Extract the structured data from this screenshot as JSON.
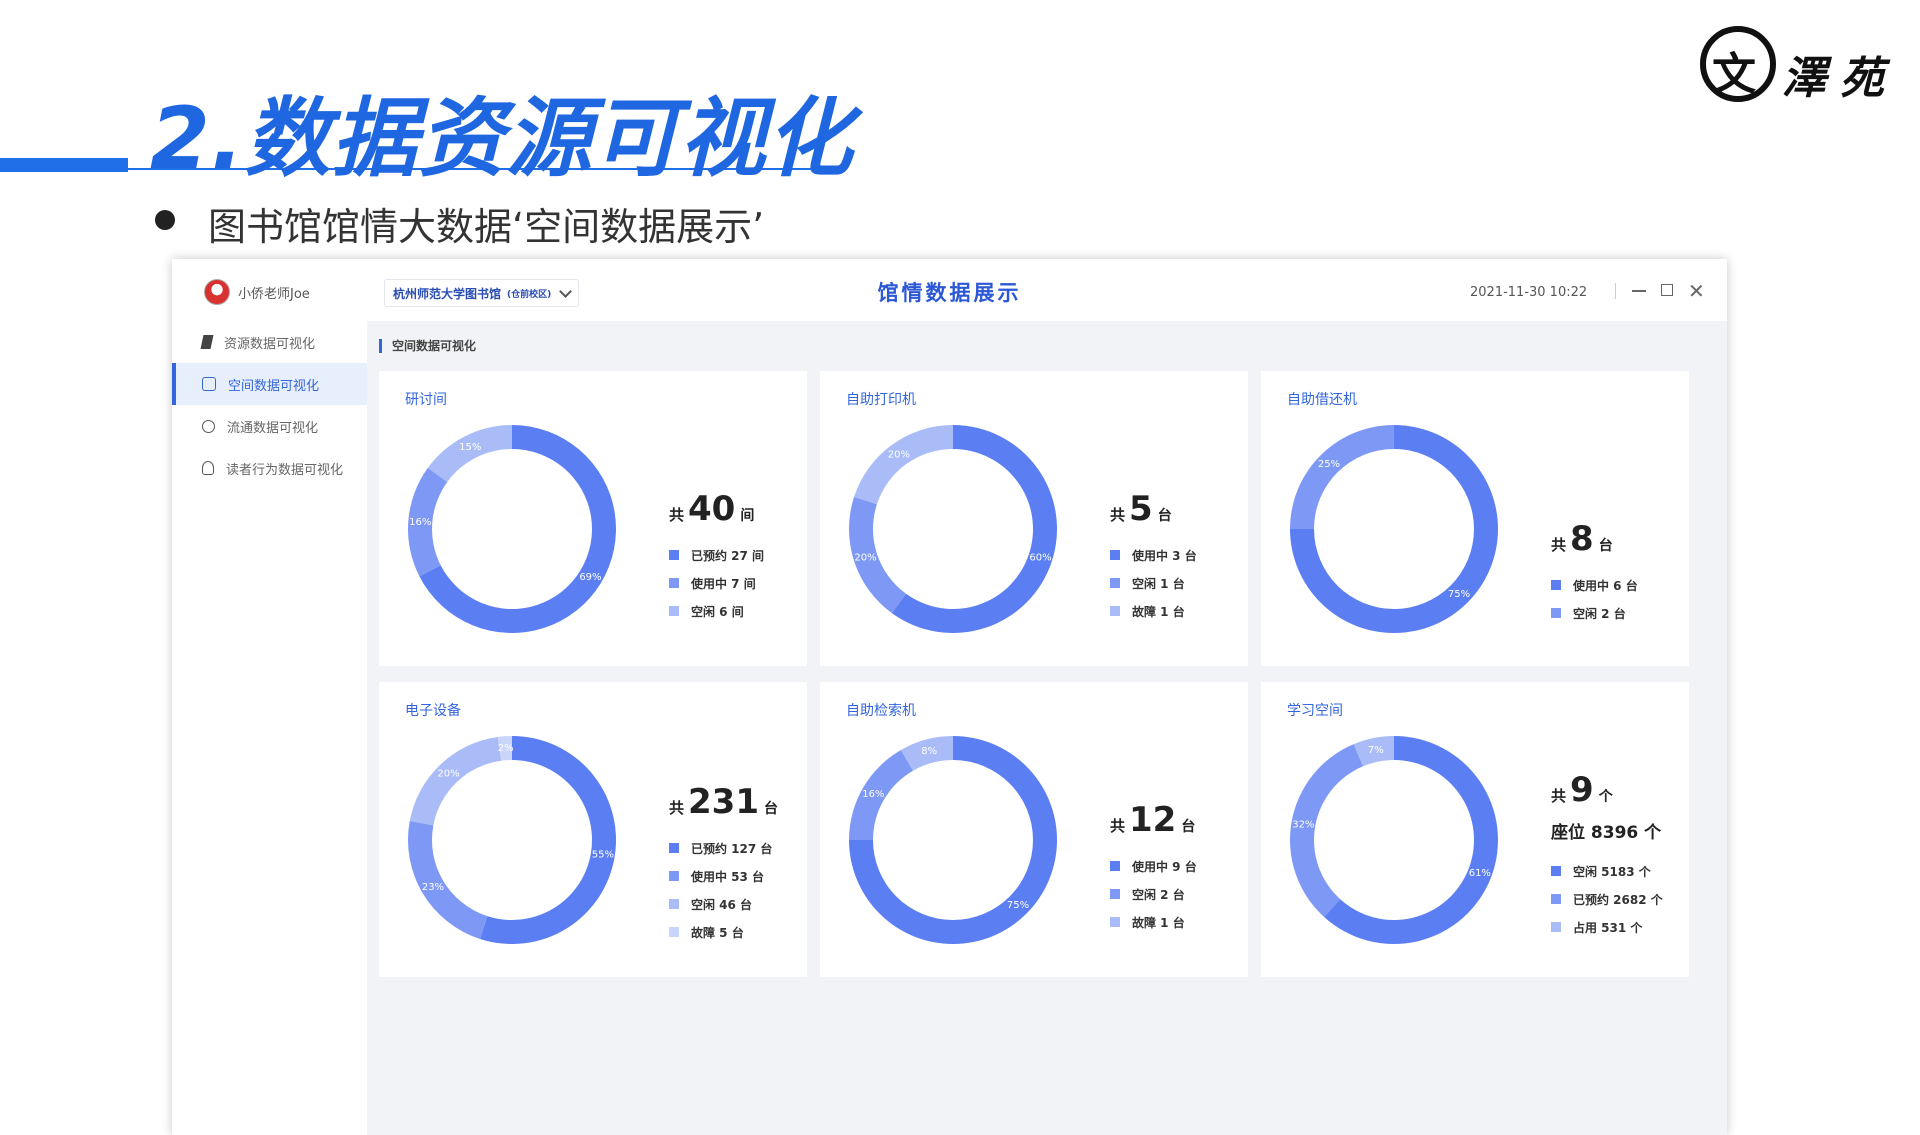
{
  "slide": {
    "title": "2.数据资源可视化",
    "subtitle": "图书馆馆情大数据‘空间数据展示’",
    "logo": {
      "seal_char": "文",
      "text1": "澤",
      "text2": "苑"
    }
  },
  "app": {
    "user_name": "小侨老师Joe",
    "library_select": {
      "label": "杭州师范大学图书馆",
      "sub": "(仓前校区)"
    },
    "title": "馆情数据展示",
    "datetime": "2021-11-30  10:22",
    "window_controls": {
      "minimize_icon": "minimize-icon",
      "maximize_icon": "maximize-icon",
      "close_icon": "close-icon",
      "close_glyph": "✕"
    },
    "breadcrumb": "空间数据可视化",
    "nav": [
      {
        "label": "资源数据可视化",
        "icon": "book-icon"
      },
      {
        "label": "空间数据可视化",
        "icon": "cube-icon",
        "active": true
      },
      {
        "label": "流通数据可视化",
        "icon": "cycle-icon"
      },
      {
        "label": "读者行为数据可视化",
        "icon": "user-icon"
      }
    ]
  },
  "colors": {
    "c1": "#5b7ff2",
    "c2": "#7e98f5",
    "c3": "#a9bcf8",
    "c4": "#c9d5fb",
    "accent": "#1e6fe8"
  },
  "chart_data": [
    {
      "type": "pie",
      "title": "研讨间",
      "total_prefix": "共",
      "total": "40",
      "unit": "间",
      "slices": [
        {
          "label": "已预约 27 间",
          "value": 27,
          "pct": "69%"
        },
        {
          "label": "使用中 7 间",
          "value": 7,
          "pct": "16%"
        },
        {
          "label": "空闲 6 间",
          "value": 6,
          "pct": "15%"
        }
      ]
    },
    {
      "type": "pie",
      "title": "自助打印机",
      "total_prefix": "共",
      "total": "5",
      "unit": "台",
      "slices": [
        {
          "label": "使用中 3 台",
          "value": 3,
          "pct": "60%"
        },
        {
          "label": "空闲 1 台",
          "value": 1,
          "pct": "20%"
        },
        {
          "label": "故障 1 台",
          "value": 1,
          "pct": "20%"
        }
      ]
    },
    {
      "type": "pie",
      "title": "自助借还机",
      "total_prefix": "共",
      "total": "8",
      "unit": "台",
      "slices": [
        {
          "label": "使用中 6 台",
          "value": 6,
          "pct": "75%"
        },
        {
          "label": "空闲 2 台",
          "value": 2,
          "pct": "25%"
        }
      ]
    },
    {
      "type": "pie",
      "title": "电子设备",
      "total_prefix": "共",
      "total": "231",
      "unit": "台",
      "slices": [
        {
          "label": "已预约 127 台",
          "value": 127,
          "pct": "55%"
        },
        {
          "label": "使用中 53 台",
          "value": 53,
          "pct": "23%"
        },
        {
          "label": "空闲 46 台",
          "value": 46,
          "pct": "20%"
        },
        {
          "label": "故障 5 台",
          "value": 5,
          "pct": "2%"
        }
      ]
    },
    {
      "type": "pie",
      "title": "自助检索机",
      "total_prefix": "共",
      "total": "12",
      "unit": "台",
      "slices": [
        {
          "label": "使用中 9 台",
          "value": 9,
          "pct": "75%"
        },
        {
          "label": "空闲 2 台",
          "value": 2,
          "pct": "16%"
        },
        {
          "label": "故障 1 台",
          "value": 1,
          "pct": "8%"
        }
      ]
    },
    {
      "type": "pie",
      "title": "学习空间",
      "total_prefix": "共",
      "total": "9",
      "unit": "个",
      "seats": "座位 8396 个",
      "slices": [
        {
          "label": "空闲 5183 个",
          "value": 5183,
          "pct": "61%"
        },
        {
          "label": "已预约 2682 个",
          "value": 2682,
          "pct": "32%"
        },
        {
          "label": "占用 531 个",
          "value": 531,
          "pct": "7%"
        }
      ]
    }
  ]
}
